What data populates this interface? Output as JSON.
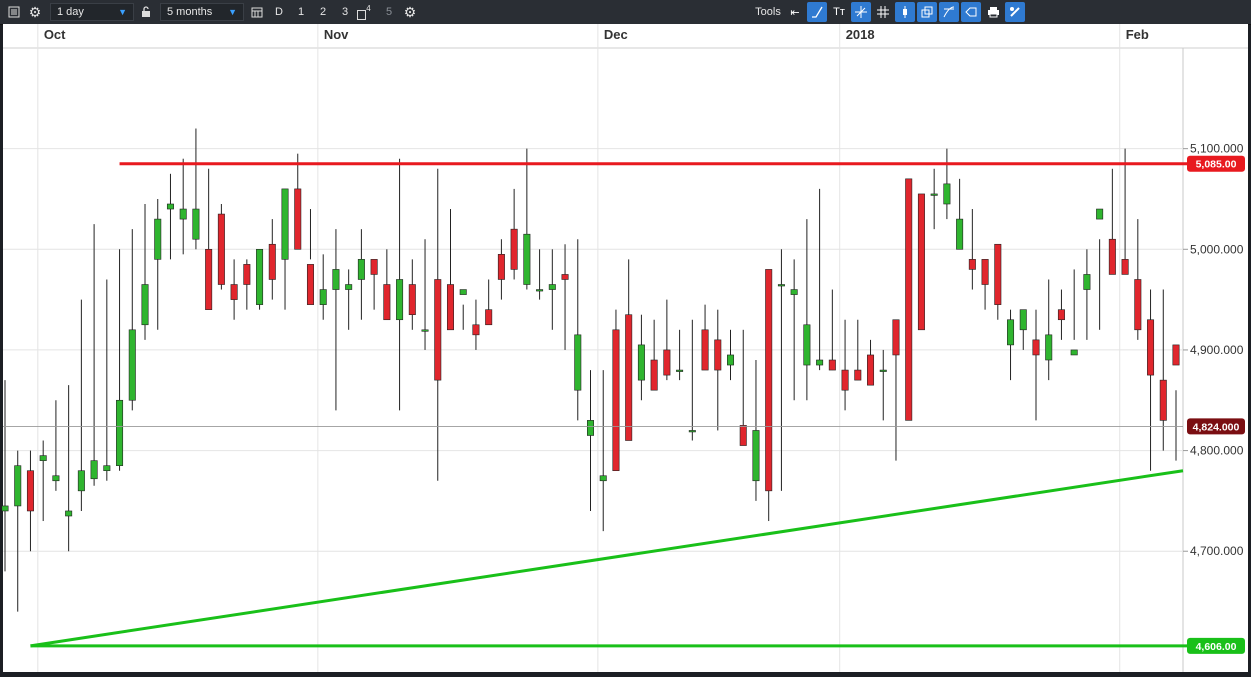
{
  "toolbar": {
    "interval": "1 day",
    "range": "5 months",
    "intervals": [
      "D",
      "1",
      "2",
      "3",
      "4",
      "5"
    ],
    "tools_label": "Tools",
    "tools": [
      "arrow-icon",
      "line-icon",
      "text-icon",
      "crosshair-icon",
      "grid-icon",
      "candle-icon",
      "window-icon",
      "fib-icon",
      "shape-icon",
      "print-icon",
      "settings-icon"
    ]
  },
  "chart_data": {
    "type": "candlestick",
    "months": [
      {
        "label": "Oct",
        "date": "2017-10-02"
      },
      {
        "label": "Nov",
        "date": "2017-11-01"
      },
      {
        "label": "Dec",
        "date": "2017-12-01"
      },
      {
        "label": "2018",
        "date": "2018-01-02"
      },
      {
        "label": "Feb",
        "date": "2018-02-01"
      }
    ],
    "ylim": [
      4580,
      5200
    ],
    "y_ticks": [
      "5,100.000",
      "5,000.000",
      "4,900.000",
      "4,800.000",
      "4,700.000"
    ],
    "dates": [
      "2017-09-27",
      "2017-09-28",
      "2017-09-29",
      "2017-10-02",
      "2017-10-03",
      "2017-10-04",
      "2017-10-05",
      "2017-10-06",
      "2017-10-09",
      "2017-10-10",
      "2017-10-11",
      "2017-10-12",
      "2017-10-13",
      "2017-10-16",
      "2017-10-17",
      "2017-10-18",
      "2017-10-19",
      "2017-10-20",
      "2017-10-23",
      "2017-10-24",
      "2017-10-25",
      "2017-10-26",
      "2017-10-27",
      "2017-10-30",
      "2017-10-31",
      "2017-11-01",
      "2017-11-02",
      "2017-11-03",
      "2017-11-06",
      "2017-11-07",
      "2017-11-08",
      "2017-11-09",
      "2017-11-10",
      "2017-11-13",
      "2017-11-14",
      "2017-11-15",
      "2017-11-16",
      "2017-11-17",
      "2017-11-20",
      "2017-11-21",
      "2017-11-22",
      "2017-11-23",
      "2017-11-24",
      "2017-11-27",
      "2017-11-28",
      "2017-11-29",
      "2017-11-30",
      "2017-12-01",
      "2017-12-04",
      "2017-12-05",
      "2017-12-06",
      "2017-12-07",
      "2017-12-08",
      "2017-12-11",
      "2017-12-12",
      "2017-12-13",
      "2017-12-14",
      "2017-12-15",
      "2017-12-18",
      "2017-12-19",
      "2017-12-20",
      "2017-12-21",
      "2017-12-22",
      "2017-12-27",
      "2017-12-28",
      "2017-12-29",
      "2018-01-02",
      "2018-01-03",
      "2018-01-04",
      "2018-01-05",
      "2018-01-08",
      "2018-01-09",
      "2018-01-10",
      "2018-01-11",
      "2018-01-12",
      "2018-01-15",
      "2018-01-16",
      "2018-01-17",
      "2018-01-18",
      "2018-01-19",
      "2018-01-22",
      "2018-01-23",
      "2018-01-24",
      "2018-01-25",
      "2018-01-26",
      "2018-01-29",
      "2018-01-30",
      "2018-01-31",
      "2018-02-01",
      "2018-02-02",
      "2018-02-05",
      "2018-02-06",
      "2018-02-07"
    ],
    "open": [
      4740,
      4745,
      4780,
      4790,
      4770,
      4735,
      4760,
      4772,
      4780,
      4785,
      4850,
      4925,
      4990,
      5040,
      5030,
      5010,
      5000,
      5035,
      4965,
      4985,
      4945,
      5005,
      4990,
      5060,
      4985,
      4945,
      4960,
      4960,
      4970,
      4990,
      4965,
      4930,
      4965,
      4920,
      4970,
      4965,
      4955,
      4925,
      4940,
      4995,
      5020,
      4965,
      4960,
      4960,
      4975,
      4860,
      4815,
      4770,
      4920,
      4935,
      4870,
      4890,
      4900,
      4880,
      4820,
      4920,
      4910,
      4885,
      4825,
      4770,
      4980,
      4965,
      4955,
      4885,
      4885,
      4890,
      4880,
      4880,
      4895,
      4880,
      4930,
      5070,
      5055,
      5055,
      5045,
      5000,
      4990,
      4990,
      5005,
      4905,
      4920,
      4910,
      4890,
      4940,
      4895,
      4960,
      5030,
      5010,
      4990,
      4970,
      4930,
      4870,
      4905
    ],
    "high": [
      4870,
      4800,
      4800,
      4810,
      4850,
      4865,
      4950,
      5025,
      4970,
      5000,
      5020,
      5045,
      5050,
      5075,
      5090,
      5120,
      5080,
      5045,
      4990,
      4990,
      4965,
      5030,
      5060,
      5095,
      5040,
      4995,
      5020,
      4980,
      5020,
      4980,
      5000,
      5090,
      4990,
      5010,
      5080,
      5040,
      4945,
      4950,
      4970,
      5010,
      5060,
      5100,
      5000,
      5000,
      5005,
      5010,
      4880,
      4880,
      4940,
      4990,
      4935,
      4930,
      4950,
      4920,
      4930,
      4945,
      4940,
      4920,
      4920,
      4890,
      4850,
      5000,
      4990,
      5030,
      5060,
      4960,
      4930,
      4930,
      4910,
      4900,
      4930,
      4940,
      4980,
      5080,
      5100,
      5070,
      5040,
      4990,
      4990,
      4940,
      4930,
      4940,
      4970,
      4960,
      4980,
      5000,
      5010,
      5080,
      5100,
      5030,
      4960,
      4960,
      4860
    ],
    "low": [
      4680,
      4640,
      4700,
      4730,
      4760,
      4700,
      4740,
      4765,
      4770,
      4780,
      4840,
      4910,
      4920,
      4990,
      4995,
      5000,
      4940,
      4960,
      4930,
      4940,
      4940,
      4950,
      4940,
      5000,
      4990,
      4930,
      4840,
      4920,
      4930,
      4940,
      4940,
      4840,
      4920,
      4900,
      4770,
      4940,
      4920,
      4900,
      4940,
      4950,
      4970,
      4960,
      4950,
      4920,
      4900,
      4830,
      4740,
      4720,
      4790,
      4860,
      4850,
      4880,
      4870,
      4870,
      4810,
      4900,
      4820,
      4870,
      4820,
      4750,
      4730,
      4760,
      4850,
      4850,
      4880,
      4880,
      4840,
      4870,
      4870,
      4830,
      4790,
      4910,
      5000,
      5020,
      5030,
      5000,
      4960,
      4940,
      4930,
      4870,
      4900,
      4830,
      4870,
      4910,
      4910,
      4910,
      4920,
      4990,
      4980,
      4910,
      4780,
      4800,
      4790
    ],
    "close": [
      4745,
      4785,
      4740,
      4795,
      4775,
      4740,
      4780,
      4790,
      4785,
      4850,
      4920,
      4965,
      5030,
      5045,
      5040,
      5040,
      4940,
      4965,
      4950,
      4965,
      5000,
      4970,
      5060,
      5000,
      4945,
      4960,
      4980,
      4965,
      4990,
      4975,
      4930,
      4970,
      4935,
      4920,
      4870,
      4920,
      4960,
      4915,
      4925,
      4970,
      4980,
      5015,
      4960,
      4965,
      4970,
      4915,
      4830,
      4775,
      4780,
      4810,
      4905,
      4860,
      4875,
      4880,
      4820,
      4880,
      4880,
      4895,
      4805,
      4820,
      4760,
      4965,
      4960,
      4925,
      4890,
      4880,
      4860,
      4870,
      4865,
      4880,
      4895,
      4830,
      4920,
      5055,
      5065,
      5030,
      4980,
      4965,
      4945,
      4930,
      4940,
      4895,
      4915,
      4930,
      4900,
      4975,
      5040,
      4975,
      4975,
      4920,
      4875,
      4830,
      4885
    ],
    "lines": [
      {
        "kind": "horizontal",
        "value": 5085,
        "color": "#e8191f",
        "label": "5,085.00"
      },
      {
        "kind": "horizontal",
        "value": 4606,
        "color": "#19c019",
        "label": "4,606.00"
      },
      {
        "kind": "trend",
        "start_date": "2017-09-29",
        "start": 4606,
        "end_date": "2018-02-07",
        "end": 4780,
        "color": "#19c019"
      },
      {
        "kind": "price",
        "value": 4824,
        "color": "#7a0e12",
        "label": "4,824.000"
      }
    ],
    "colors": {
      "up": "#2fb52f",
      "down": "#e0262d",
      "background": "#ffffff",
      "grid": "#e4e4e4"
    }
  }
}
